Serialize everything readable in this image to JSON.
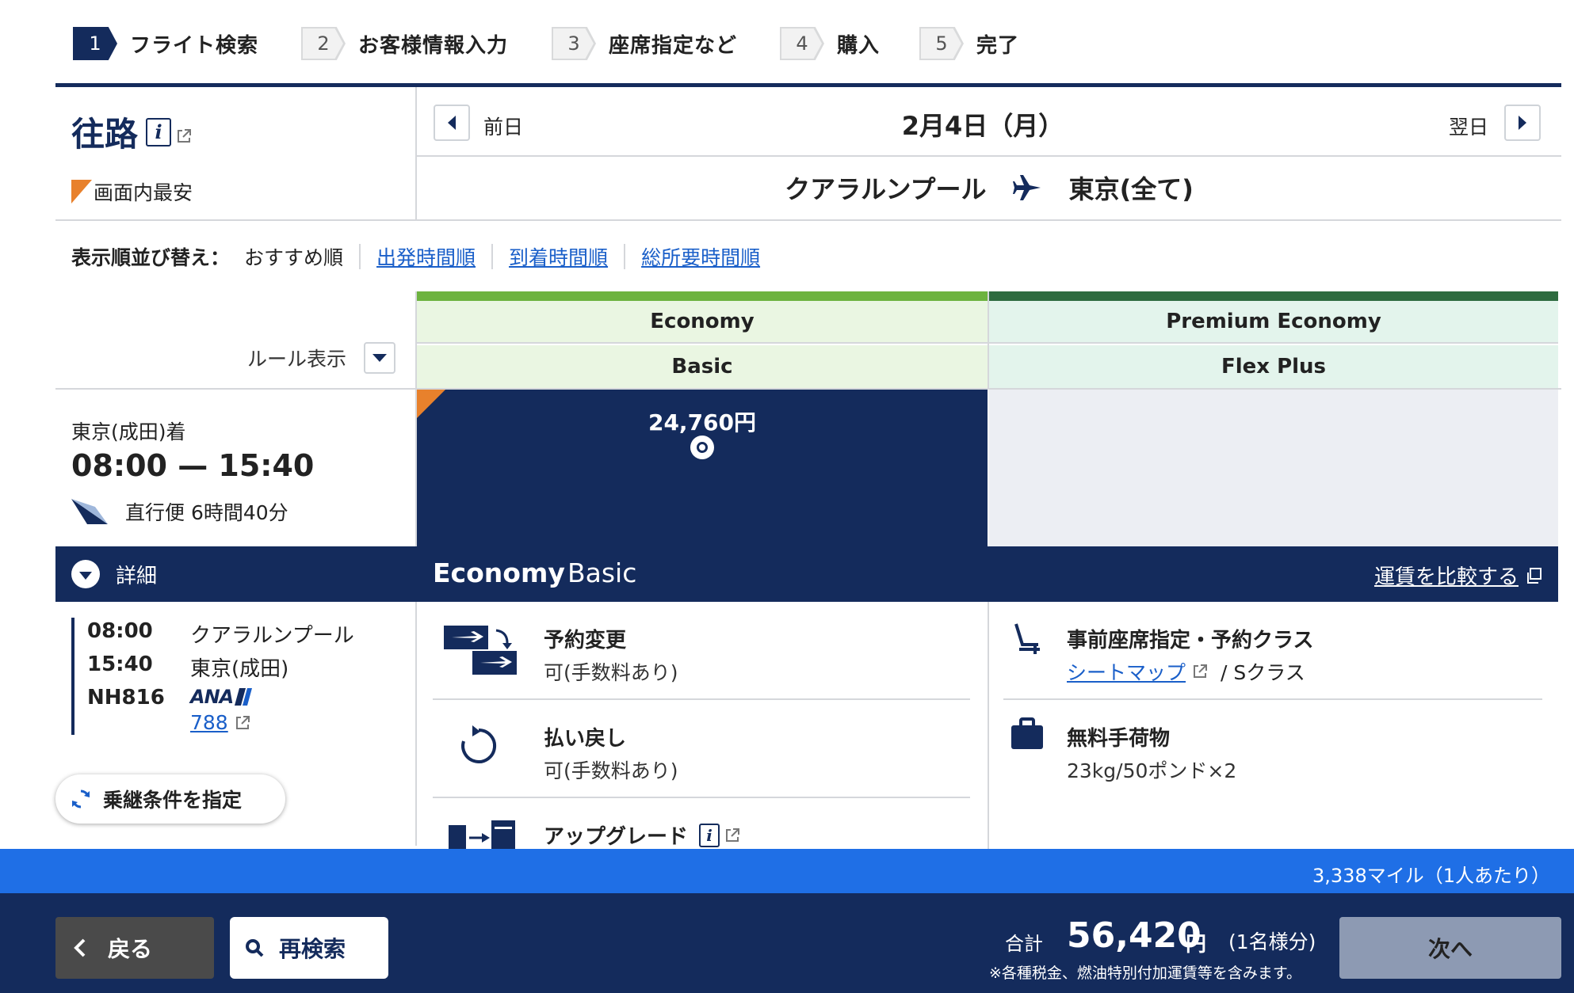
{
  "steps": [
    {
      "num": "1",
      "label": "フライト検索",
      "active": true
    },
    {
      "num": "2",
      "label": "お客様情報入力",
      "active": false
    },
    {
      "num": "3",
      "label": "座席指定など",
      "active": false
    },
    {
      "num": "4",
      "label": "購入",
      "active": false
    },
    {
      "num": "5",
      "label": "完了",
      "active": false
    }
  ],
  "leg": {
    "title": "往路",
    "cheapest_label": "画面内最安",
    "prev_day": "前日",
    "next_day": "翌日",
    "date": "2月4日（月）",
    "origin": "クアラルンプール",
    "destination": "東京(全て)"
  },
  "sort": {
    "label": "表示順並び替え：",
    "current": "おすすめ順",
    "options": [
      "出発時間順",
      "到着時間順",
      "総所要時間順"
    ]
  },
  "rules_toggle": "ルール表示",
  "fare_columns": [
    {
      "cabin": "Economy",
      "fare": "Basic",
      "accent": "#6db33f"
    },
    {
      "cabin": "Premium Economy",
      "fare": "Flex Plus",
      "accent": "#2e6b3f"
    }
  ],
  "flight": {
    "arrival_label": "東京(成田)着",
    "times": "08:00 — 15:40",
    "duration": "直行便 6時間40分",
    "price": "24,760円",
    "details_label": "詳細",
    "segments": [
      {
        "time": "08:00",
        "place": "クアラルンプール"
      },
      {
        "time": "15:40",
        "place": "東京(成田)"
      }
    ],
    "flight_no": "NH816",
    "airline_logo_text": "ANA",
    "aircraft": "788"
  },
  "connection_button": "乗継条件を指定",
  "fare_detail": {
    "cabin": "Economy",
    "fare": "Basic",
    "compare_link": "運賃を比較する",
    "features_left": [
      {
        "icon": "ticket-change-icon",
        "title": "予約変更",
        "sub": "可(手数料あり)"
      },
      {
        "icon": "refund-icon",
        "title": "払い戻し",
        "sub": "可(手数料あり)"
      },
      {
        "icon": "upgrade-icon",
        "title": "アップグレード",
        "sub": ""
      }
    ],
    "seat_title": "事前座席指定・予約クラス",
    "seat_map_link": "シートマップ",
    "booking_class": "/ Sクラス",
    "baggage_title": "無料手荷物",
    "baggage_sub": "23kg/50ポンド×2"
  },
  "miles": "3,338マイル（1人あたり）",
  "footer": {
    "back": "戻る",
    "research": "再検索",
    "total_label": "合計",
    "total_amount": "56,420",
    "currency": "円",
    "pax": "(1名様分)",
    "note": "※各種税金、燃油特別付加運賃等を含みます。",
    "next": "次へ"
  },
  "colors": {
    "navy": "#142b5c",
    "link": "#1a5fc9",
    "economy_accent": "#6db33f",
    "premium_accent": "#2e6b3f",
    "miles_bar": "#1f6fe6",
    "cheapest_marker": "#e8812c"
  }
}
